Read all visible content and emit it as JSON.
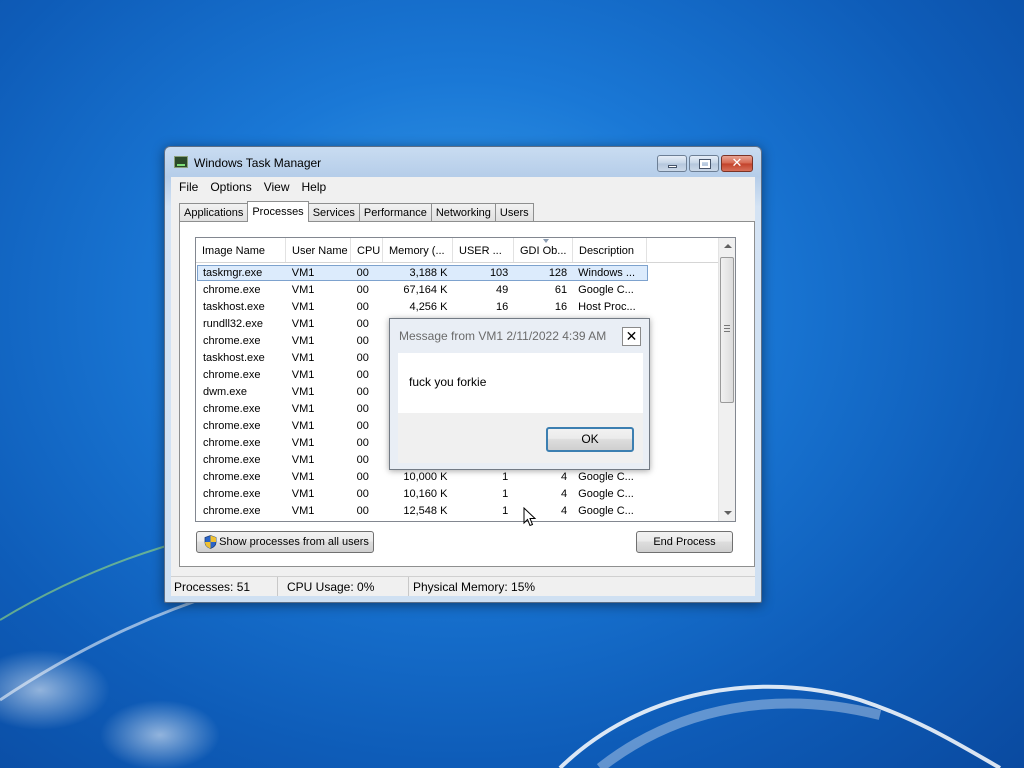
{
  "window": {
    "title": "Windows Task Manager",
    "controls": {
      "close": "✕"
    }
  },
  "menubar": [
    "File",
    "Options",
    "View",
    "Help"
  ],
  "tabs": [
    "Applications",
    "Processes",
    "Services",
    "Performance",
    "Networking",
    "Users"
  ],
  "active_tab": "Processes",
  "table": {
    "columns": [
      "Image Name",
      "User Name",
      "CPU",
      "Memory (...",
      "USER ...",
      "GDI Ob...",
      "Description"
    ],
    "rows": [
      [
        "taskmgr.exe",
        "VM1",
        "00",
        "3,188 K",
        "103",
        "128",
        "Windows ..."
      ],
      [
        "chrome.exe",
        "VM1",
        "00",
        "67,164 K",
        "49",
        "61",
        "Google C..."
      ],
      [
        "taskhost.exe",
        "VM1",
        "00",
        "4,256 K",
        "16",
        "16",
        "Host Proc..."
      ],
      [
        "rundll32.exe",
        "VM1",
        "00",
        "",
        "",
        "",
        ""
      ],
      [
        "chrome.exe",
        "VM1",
        "00",
        "",
        "",
        "",
        ""
      ],
      [
        "taskhost.exe",
        "VM1",
        "00",
        "",
        "",
        "",
        ""
      ],
      [
        "chrome.exe",
        "VM1",
        "00",
        "",
        "",
        "",
        ""
      ],
      [
        "dwm.exe",
        "VM1",
        "00",
        "",
        "",
        "",
        ""
      ],
      [
        "chrome.exe",
        "VM1",
        "00",
        "",
        "",
        "",
        ""
      ],
      [
        "chrome.exe",
        "VM1",
        "00",
        "",
        "",
        "",
        ""
      ],
      [
        "chrome.exe",
        "VM1",
        "00",
        "",
        "",
        "",
        ""
      ],
      [
        "chrome.exe",
        "VM1",
        "00",
        "",
        "",
        "",
        ""
      ],
      [
        "chrome.exe",
        "VM1",
        "00",
        "10,000 K",
        "1",
        "4",
        "Google C..."
      ],
      [
        "chrome.exe",
        "VM1",
        "00",
        "10,160 K",
        "1",
        "4",
        "Google C..."
      ],
      [
        "chrome.exe",
        "VM1",
        "00",
        "12,548 K",
        "1",
        "4",
        "Google C..."
      ]
    ],
    "selected_row": 0
  },
  "buttons": {
    "show_all": "Show processes from all users",
    "end_process": "End Process"
  },
  "status": {
    "processes": "Processes: 51",
    "cpu": "CPU Usage: 0%",
    "memory": "Physical Memory: 15%"
  },
  "dialog": {
    "title": "Message from VM1 2/11/2022 4:39 AM",
    "close": "✕",
    "message": "fuck you forkie",
    "ok": "OK"
  },
  "colors": {
    "desktop": "#1a78d6",
    "selection": "#dcebfc",
    "selection_border": "#7da2ce"
  }
}
